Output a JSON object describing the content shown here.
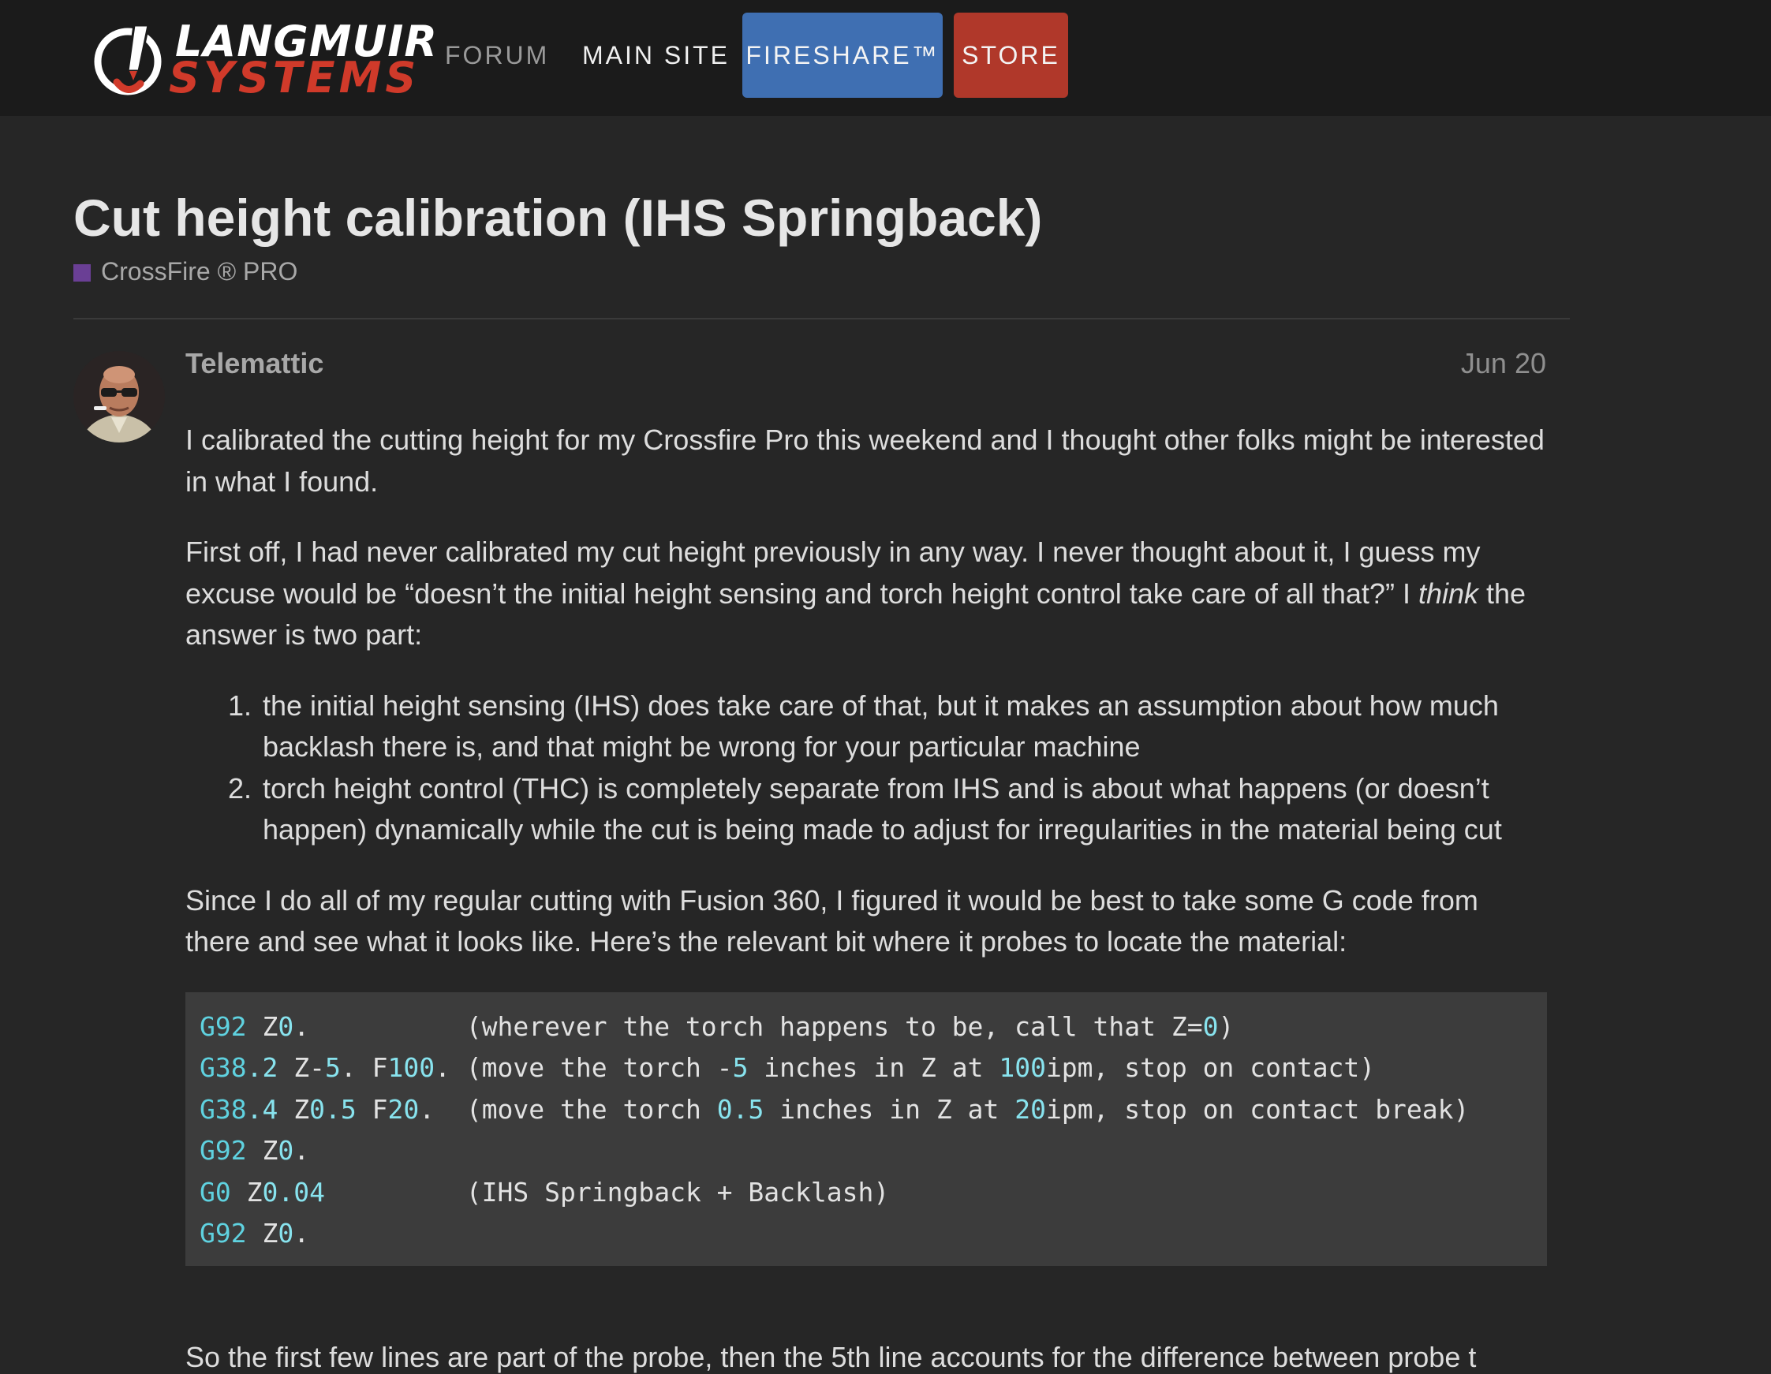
{
  "header": {
    "logo": {
      "line1": "LANGMUIR",
      "line2": "SYSTEMS"
    },
    "nav": [
      {
        "label": "FORUM"
      },
      {
        "label": "MAIN SITE"
      },
      {
        "label": "FIRESHARE™"
      },
      {
        "label": "STORE"
      }
    ],
    "colors": {
      "background": "#1b1b1b",
      "fireshare": "#3f6fb2",
      "store": "#b0382a",
      "logo_red": "#d03a2a"
    }
  },
  "topic": {
    "title": "Cut height calibration (IHS Springback)",
    "category": {
      "label": "CrossFire ® PRO",
      "color": "#6a3f95"
    }
  },
  "post": {
    "username": "Telemattic",
    "date": "Jun 20",
    "avatar_icon": "user-avatar-icon",
    "p1": "I calibrated the cutting height for my Crossfire Pro this weekend and I thought other folks might be interested in what I found.",
    "p2_before": "First off, I had never calibrated my cut height previously in any way. I never thought about it, I guess my excuse would be “doesn’t the initial height sensing and torch height control take care of all that?” I ",
    "p2_em": "think",
    "p2_after": " the answer is two part:",
    "list": [
      "the initial height sensing (IHS) does take care of that, but it makes an assumption about how much backlash there is, and that might be wrong for your particular machine",
      "torch height control (THC) is completely separate from IHS and is about what happens (or doesn’t happen) dynamically while the cut is being made to adjust for irregularities in the material being cut"
    ],
    "p3": "Since I do all of my regular cutting with Fusion 360, I figured it would be best to take some G code from there and see what it looks like. Here’s the relevant bit where it probes to locate the material:",
    "code": {
      "l1": {
        "kw": "G92",
        "a": " Z",
        "n1": "0",
        "b": ".          (wherever the torch happens to be, call that Z=",
        "n2": "0",
        "c": ")"
      },
      "l2": {
        "kw": "G38",
        "n1": ".2",
        "a": " Z-",
        "n2": "5",
        "b": ". F",
        "n3": "100",
        "c": ". (move the torch -",
        "n4": "5",
        "d": " inches in Z at ",
        "n5": "100",
        "e": "ipm, stop on contact)"
      },
      "l3": {
        "kw": "G38",
        "n1": ".4",
        "a": " Z",
        "n2": "0.5",
        "b": " F",
        "n3": "20",
        "c": ".  (move the torch ",
        "n4": "0.5",
        "d": " inches in Z at ",
        "n5": "20",
        "e": "ipm, stop on contact break)"
      },
      "l4": {
        "kw": "G92",
        "a": " Z",
        "n1": "0",
        "b": "."
      },
      "l5": {
        "kw": "G0",
        "a": " Z",
        "n1": "0.04",
        "b": "         (IHS Springback + Backlash)"
      },
      "l6": {
        "kw": "G92",
        "a": " Z",
        "n1": "0",
        "b": "."
      }
    },
    "trailing": "So the first few lines are part of the probe, then the 5th line accounts for the difference between probe t"
  }
}
